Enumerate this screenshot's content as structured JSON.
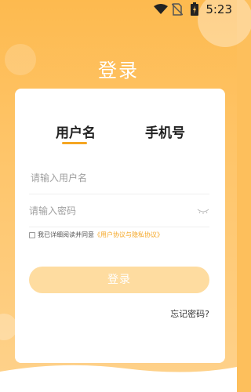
{
  "status": {
    "time": "5:23",
    "icons": [
      "wifi-icon",
      "no-sim-icon",
      "battery-charging-icon"
    ]
  },
  "page": {
    "title": "登录"
  },
  "tabs": {
    "username_label": "用户名",
    "phone_label": "手机号",
    "active": "username"
  },
  "form": {
    "username_placeholder": "请输入用户名",
    "password_placeholder": "请输入密码",
    "agree_prefix": "我已详细阅读并同意",
    "agree_link": "《用户协议与隐私协议》",
    "login_label": "登录",
    "forgot_label": "忘记密码?"
  },
  "colors": {
    "accent": "#f5a623",
    "background": "#fdbf5c",
    "button": "#fedca0"
  }
}
